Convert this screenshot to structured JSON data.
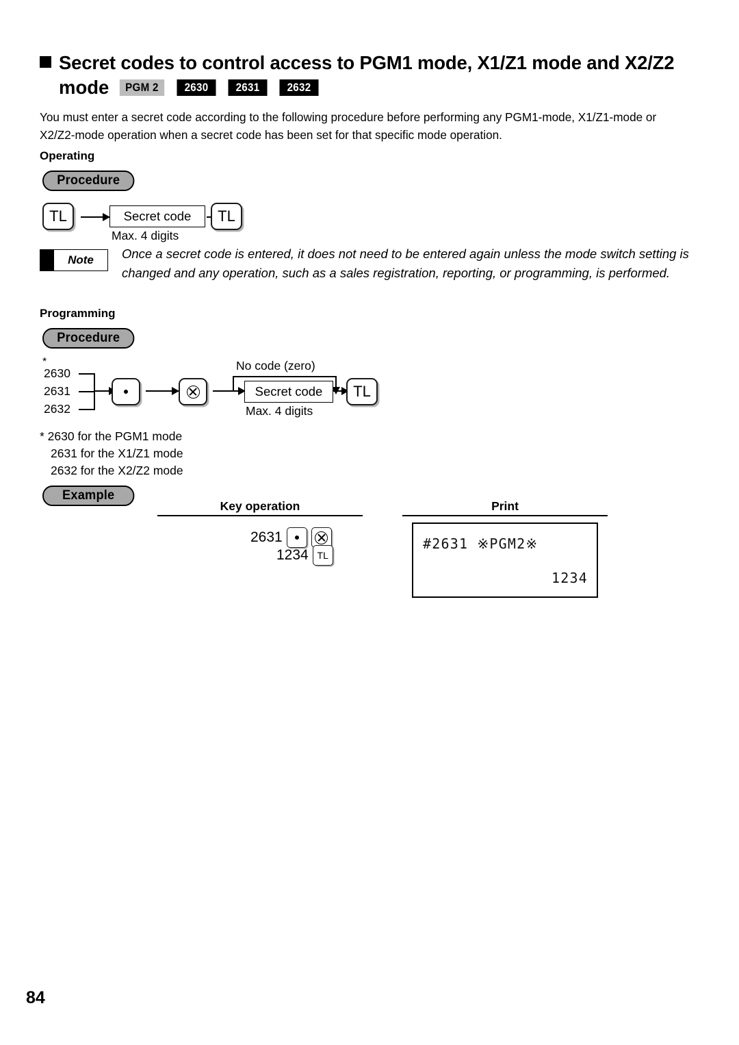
{
  "page": {
    "number": "84"
  },
  "header": {
    "title_line1": "Secret codes to control access to PGM1 mode, X1/Z1 mode and X2/Z2",
    "title_line2_word": "mode",
    "badges": [
      {
        "label": "PGM 2",
        "style": "gray"
      },
      {
        "label": "2630",
        "style": "black"
      },
      {
        "label": "2631",
        "style": "black"
      },
      {
        "label": "2632",
        "style": "black"
      }
    ],
    "intro": "You must enter a secret code according to the following procedure before performing any PGM1-mode, X1/Z1-mode or X2/Z2-mode operation when a secret code has been set for that specific mode operation."
  },
  "operating": {
    "section_label": "Operating",
    "pill_label": "Procedure",
    "key1": "TL",
    "box_label": "Secret code",
    "box_caption": "Max. 4 digits",
    "key2": "TL"
  },
  "note": {
    "badge_label": "Note",
    "text": "Once a secret code is entered, it does not need to be entered again unless the mode switch setting is changed and any operation, such as a sales registration, reporting, or programming, is performed."
  },
  "programming": {
    "section_label": "Programming",
    "pill_label": "Procedure",
    "asterisk": "*",
    "codes": [
      "2630",
      "2631",
      "2632"
    ],
    "dot_key": "•",
    "multiply_key": "⊗",
    "bypass_label": "No code (zero)",
    "box_label": "Secret code",
    "box_caption": "Max. 4 digits",
    "final_key": "TL",
    "footnotes": [
      "* 2630 for the PGM1 mode",
      "2631 for the X1/Z1 mode",
      "2632 for the X2/Z2 mode"
    ]
  },
  "example": {
    "pill_label": "Example",
    "key_operation_header": "Key operation",
    "print_header": "Print",
    "key_lines": [
      {
        "number": "2631",
        "keys": [
          "dot-key",
          "multiply-key"
        ]
      },
      {
        "number": "1234",
        "keys": [
          "tl-key"
        ]
      }
    ],
    "key_tl_label": "TL",
    "print_lines": [
      "#2631 ※PGM2※",
      "1234"
    ]
  }
}
